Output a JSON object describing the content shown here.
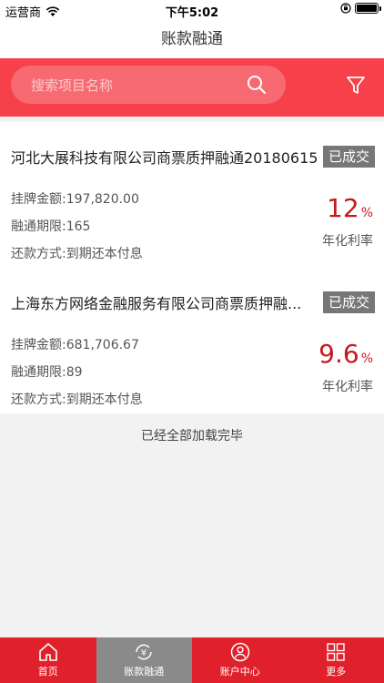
{
  "statusbar": {
    "carrier": "运营商",
    "time": "下午5:02"
  },
  "nav": {
    "title": "账款融通"
  },
  "search": {
    "placeholder": "搜索项目名称"
  },
  "items": [
    {
      "title": "河北大展科技有限公司商票质押融通20180615",
      "badge": "已成交",
      "amount": "挂牌金额:197,820.00",
      "period": "融通期限:165",
      "repay": "还款方式:到期还本付息",
      "rate": "12",
      "rate_unit": "%",
      "rate_label": "年化利率"
    },
    {
      "title": "上海东方网络金融服务有限公司商票质押融...",
      "badge": "已成交",
      "amount": "挂牌金额:681,706.67",
      "period": "融通期限:89",
      "repay": "还款方式:到期还本付息",
      "rate": "9.6",
      "rate_unit": "%",
      "rate_label": "年化利率"
    }
  ],
  "footer_note": "已经全部加载完毕",
  "tabs": [
    {
      "label": "首页",
      "icon": "home-icon",
      "active": false
    },
    {
      "label": "账款融通",
      "icon": "yuan-cycle-icon",
      "active": true
    },
    {
      "label": "账户中心",
      "icon": "user-icon",
      "active": false
    },
    {
      "label": "更多",
      "icon": "grid-icon",
      "active": false
    }
  ],
  "colors": {
    "accent": "#f6404a",
    "tabbar": "#e0202a",
    "rate": "#c8161d",
    "badge": "#777777"
  }
}
